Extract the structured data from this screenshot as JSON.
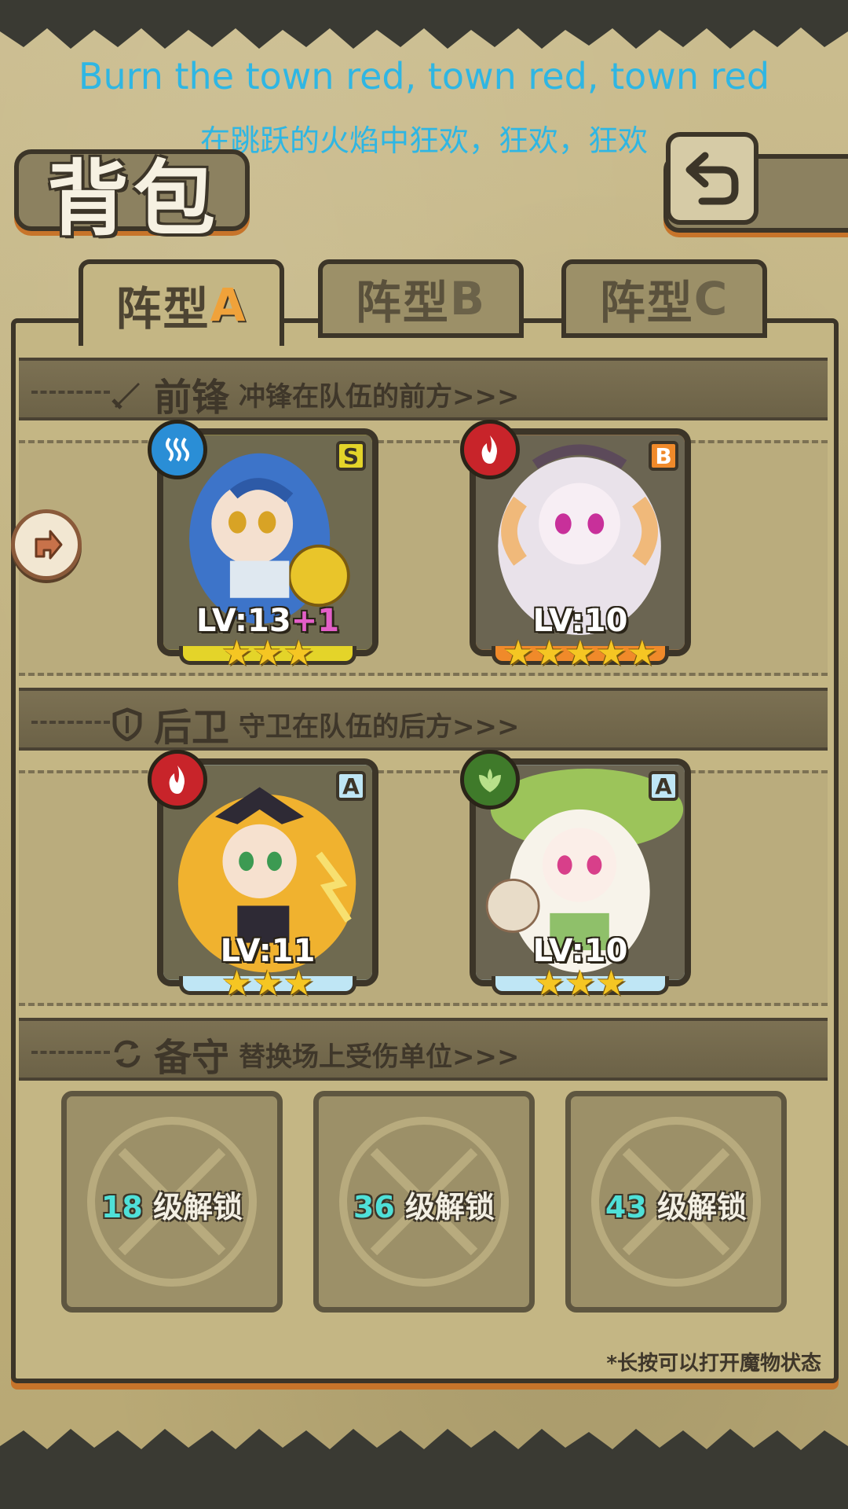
{
  "lyrics": {
    "english": "Burn the town red, town red, town red",
    "chinese": "在跳跃的火焰中狂欢，狂欢，狂欢"
  },
  "header": {
    "title": "背包"
  },
  "tabs": [
    {
      "label": "阵型",
      "letter": "A",
      "active": true
    },
    {
      "label": "阵型",
      "letter": "B",
      "active": false
    },
    {
      "label": "阵型",
      "letter": "C",
      "active": false
    }
  ],
  "sections": {
    "front": {
      "title": "前锋",
      "subtitle": "冲锋在队伍的前方>>>"
    },
    "back": {
      "title": "后卫",
      "subtitle": "守卫在队伍的后方>>>"
    },
    "reserve": {
      "title": "备守",
      "subtitle": "替换场上受伤单位>>>"
    }
  },
  "cards": [
    {
      "rank": "S",
      "element": "water",
      "level": "LV:13",
      "bonus": "+1",
      "stars": 3
    },
    {
      "rank": "B",
      "element": "fire",
      "level": "LV:10",
      "bonus": "",
      "stars": 5
    },
    {
      "rank": "A",
      "element": "fire",
      "level": "LV:11",
      "bonus": "",
      "stars": 3
    },
    {
      "rank": "A",
      "element": "nature",
      "level": "LV:10",
      "bonus": "",
      "stars": 3
    }
  ],
  "reserve_slots": [
    {
      "unlock_level": "18",
      "text": "级解锁"
    },
    {
      "unlock_level": "36",
      "text": "级解锁"
    },
    {
      "unlock_level": "43",
      "text": "级解锁"
    }
  ],
  "hint": "*长按可以打开魔物状态",
  "colors": {
    "rank_S": "#e4d429",
    "rank_B": "#f08a2a",
    "rank_A": "#bfe6f5",
    "water": "#2a8ed6",
    "fire": "#c8242a",
    "nature": "#3f7a2a"
  }
}
